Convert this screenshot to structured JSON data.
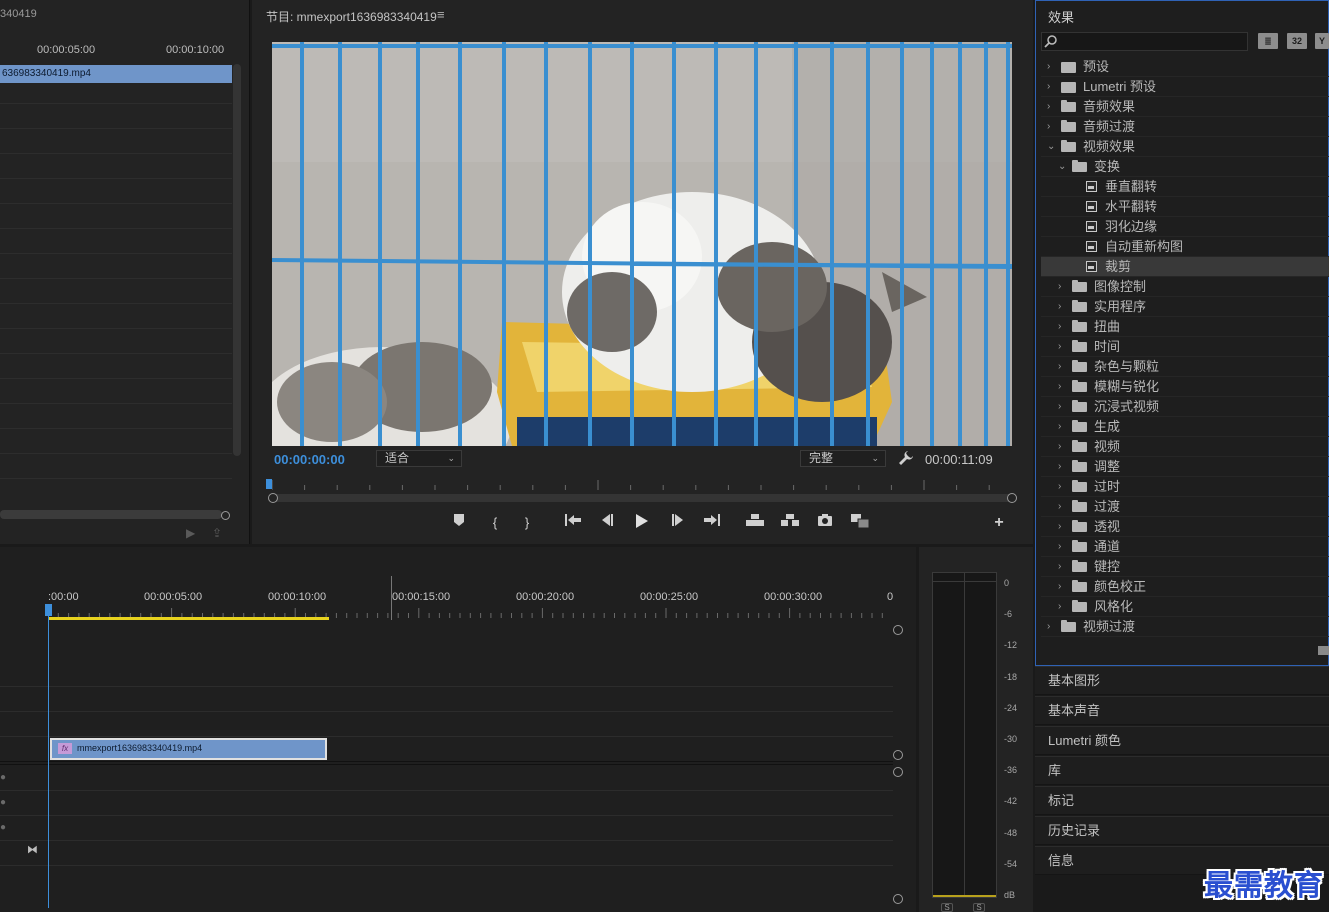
{
  "source": {
    "title": "340419",
    "ticks": [
      "00:00:05:00",
      "00:00:10:00"
    ],
    "clip_label": "636983340419.mp4"
  },
  "program": {
    "title": "节目: mmexport1636983340419",
    "menu_icon": "hamburger-icon",
    "timecode_current": "00:00:00:00",
    "fit": "适合",
    "quality": "完整",
    "timecode_duration": "00:00:11:09",
    "controls": [
      "add-marker-icon",
      "mark-in-icon",
      "mark-out-icon",
      "go-to-in-icon",
      "step-back-icon",
      "play-icon",
      "step-forward-icon",
      "go-to-out-icon",
      "lift-icon",
      "extract-icon",
      "export-frame-icon",
      "comparison-view-icon",
      "add-button-icon"
    ]
  },
  "effects": {
    "title": "效果",
    "search_placeholder": "",
    "toolbar": [
      "32"
    ],
    "tree": [
      {
        "label": "预设",
        "level": 0,
        "icon": "preset",
        "expanded": false
      },
      {
        "label": "Lumetri 预设",
        "level": 0,
        "icon": "preset",
        "expanded": false
      },
      {
        "label": "音频效果",
        "level": 0,
        "icon": "folder",
        "expanded": false
      },
      {
        "label": "音频过渡",
        "level": 0,
        "icon": "folder",
        "expanded": false
      },
      {
        "label": "视频效果",
        "level": 0,
        "icon": "folder",
        "expanded": true
      },
      {
        "label": "变换",
        "level": 1,
        "icon": "folder",
        "expanded": true
      },
      {
        "label": "垂直翻转",
        "level": 2,
        "icon": "effect"
      },
      {
        "label": "水平翻转",
        "level": 2,
        "icon": "effect"
      },
      {
        "label": "羽化边缘",
        "level": 2,
        "icon": "effect"
      },
      {
        "label": "自动重新构图",
        "level": 2,
        "icon": "effect"
      },
      {
        "label": "裁剪",
        "level": 2,
        "icon": "effect",
        "selected": true
      },
      {
        "label": "图像控制",
        "level": 1,
        "icon": "folder",
        "expanded": false
      },
      {
        "label": "实用程序",
        "level": 1,
        "icon": "folder",
        "expanded": false
      },
      {
        "label": "扭曲",
        "level": 1,
        "icon": "folder",
        "expanded": false
      },
      {
        "label": "时间",
        "level": 1,
        "icon": "folder",
        "expanded": false
      },
      {
        "label": "杂色与颗粒",
        "level": 1,
        "icon": "folder",
        "expanded": false
      },
      {
        "label": "模糊与锐化",
        "level": 1,
        "icon": "folder",
        "expanded": false
      },
      {
        "label": "沉浸式视频",
        "level": 1,
        "icon": "folder",
        "expanded": false
      },
      {
        "label": "生成",
        "level": 1,
        "icon": "folder",
        "expanded": false
      },
      {
        "label": "视频",
        "level": 1,
        "icon": "folder",
        "expanded": false
      },
      {
        "label": "调整",
        "level": 1,
        "icon": "folder",
        "expanded": false
      },
      {
        "label": "过时",
        "level": 1,
        "icon": "folder",
        "expanded": false
      },
      {
        "label": "过渡",
        "level": 1,
        "icon": "folder",
        "expanded": false
      },
      {
        "label": "透视",
        "level": 1,
        "icon": "folder",
        "expanded": false
      },
      {
        "label": "通道",
        "level": 1,
        "icon": "folder",
        "expanded": false
      },
      {
        "label": "键控",
        "level": 1,
        "icon": "folder",
        "expanded": false
      },
      {
        "label": "颜色校正",
        "level": 1,
        "icon": "folder",
        "expanded": false
      },
      {
        "label": "风格化",
        "level": 1,
        "icon": "folder",
        "expanded": false
      },
      {
        "label": "视频过渡",
        "level": 0,
        "icon": "folder",
        "expanded": false
      }
    ]
  },
  "side_panels": [
    "基本图形",
    "基本声音",
    "Lumetri 颜色",
    "库",
    "标记",
    "历史记录",
    "信息"
  ],
  "timeline": {
    "ticks": [
      ":00:00",
      "00:00:05:00",
      "00:00:10:00",
      "00:00:15:00",
      "00:00:20:00",
      "00:00:25:00",
      "00:00:30:00",
      "0"
    ],
    "clip_label": "mmexport1636983340419.mp4",
    "clip_badge": "fx"
  },
  "meter": {
    "db_labels": [
      "0",
      "-6",
      "-12",
      "-18",
      "-24",
      "-30",
      "-36",
      "-42",
      "-48",
      "-54",
      "dB"
    ],
    "solo": [
      "S",
      "S"
    ]
  },
  "watermark": "最需教育"
}
